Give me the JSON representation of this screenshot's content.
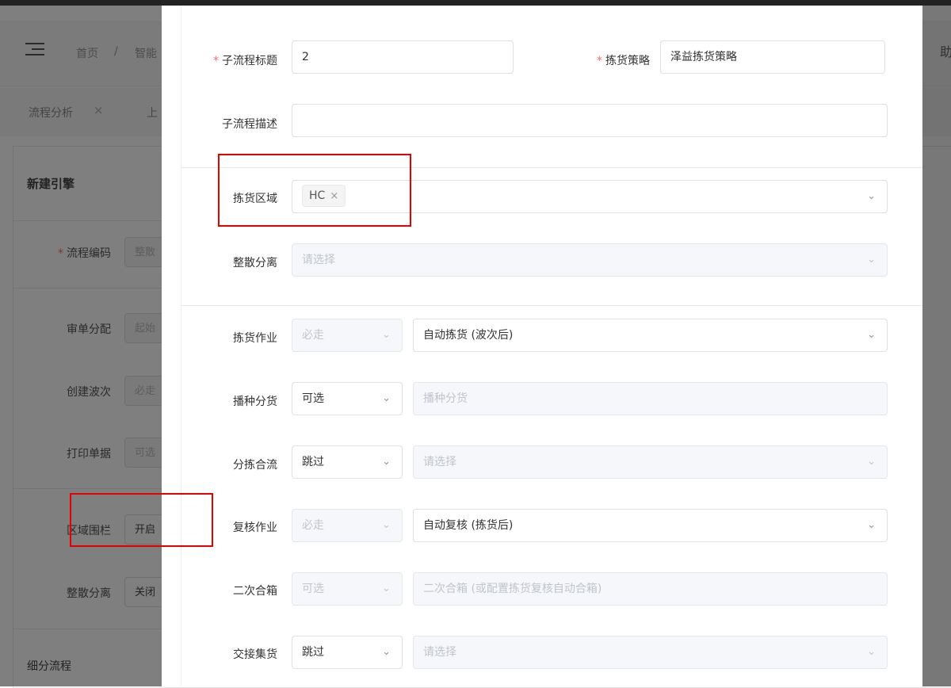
{
  "background": {
    "breadcrumb": [
      "首页",
      "/",
      "智能"
    ],
    "tabs": [
      {
        "label": "流程分析",
        "close": "×"
      },
      {
        "label": "上"
      }
    ],
    "panel_title": "新建引擎",
    "fields": [
      {
        "label": "流程编码",
        "required": true,
        "value": "整散",
        "placeholder": true
      },
      {
        "label": "审单分配",
        "value": "起始",
        "placeholder": true
      },
      {
        "label": "创建波次",
        "value": "必走",
        "placeholder": true
      },
      {
        "label": "打印单据",
        "value": "可选",
        "placeholder": true
      },
      {
        "label": "区域围栏",
        "value": "开启",
        "placeholder": false
      },
      {
        "label": "整散分离",
        "value": "关闭",
        "placeholder": false
      }
    ],
    "section": "细分流程",
    "help": "助"
  },
  "drawer": {
    "subflow_title": {
      "label": "子流程标题",
      "value": "2"
    },
    "pick_strategy": {
      "label": "拣货策略",
      "value": "泽益拣货策略"
    },
    "subflow_desc": {
      "label": "子流程描述",
      "value": ""
    },
    "pick_area": {
      "label": "拣货区域",
      "tag": "HC",
      "tag_close": "×"
    },
    "split": {
      "label": "整散分离",
      "placeholder": "请选择"
    },
    "ops": [
      {
        "label": "拣货作业",
        "mode": "必走",
        "mode_disabled": true,
        "value": "自动拣货 (波次后)",
        "value_disabled": false
      },
      {
        "label": "播种分货",
        "mode": "可选",
        "mode_disabled": false,
        "value": "播种分货",
        "value_disabled": true
      },
      {
        "label": "分拣合流",
        "mode": "跳过",
        "mode_disabled": false,
        "value": "请选择",
        "value_disabled": true
      },
      {
        "label": "复核作业",
        "mode": "必走",
        "mode_disabled": true,
        "value": "自动复核 (拣货后)",
        "value_disabled": false
      },
      {
        "label": "二次合箱",
        "mode": "可选",
        "mode_disabled": true,
        "value": "二次合箱 (或配置拣货复核自动合箱)",
        "value_disabled": true
      },
      {
        "label": "交接集货",
        "mode": "跳过",
        "mode_disabled": false,
        "value": "请选择",
        "value_disabled": true
      }
    ]
  },
  "icons": {
    "chevron": "chevron-down-icon",
    "menu": "menu-fold-icon"
  },
  "colors": {
    "required": "#f56c6c",
    "highlight": "#e60000",
    "overlay": "rgba(0,0,0,0.5)"
  }
}
